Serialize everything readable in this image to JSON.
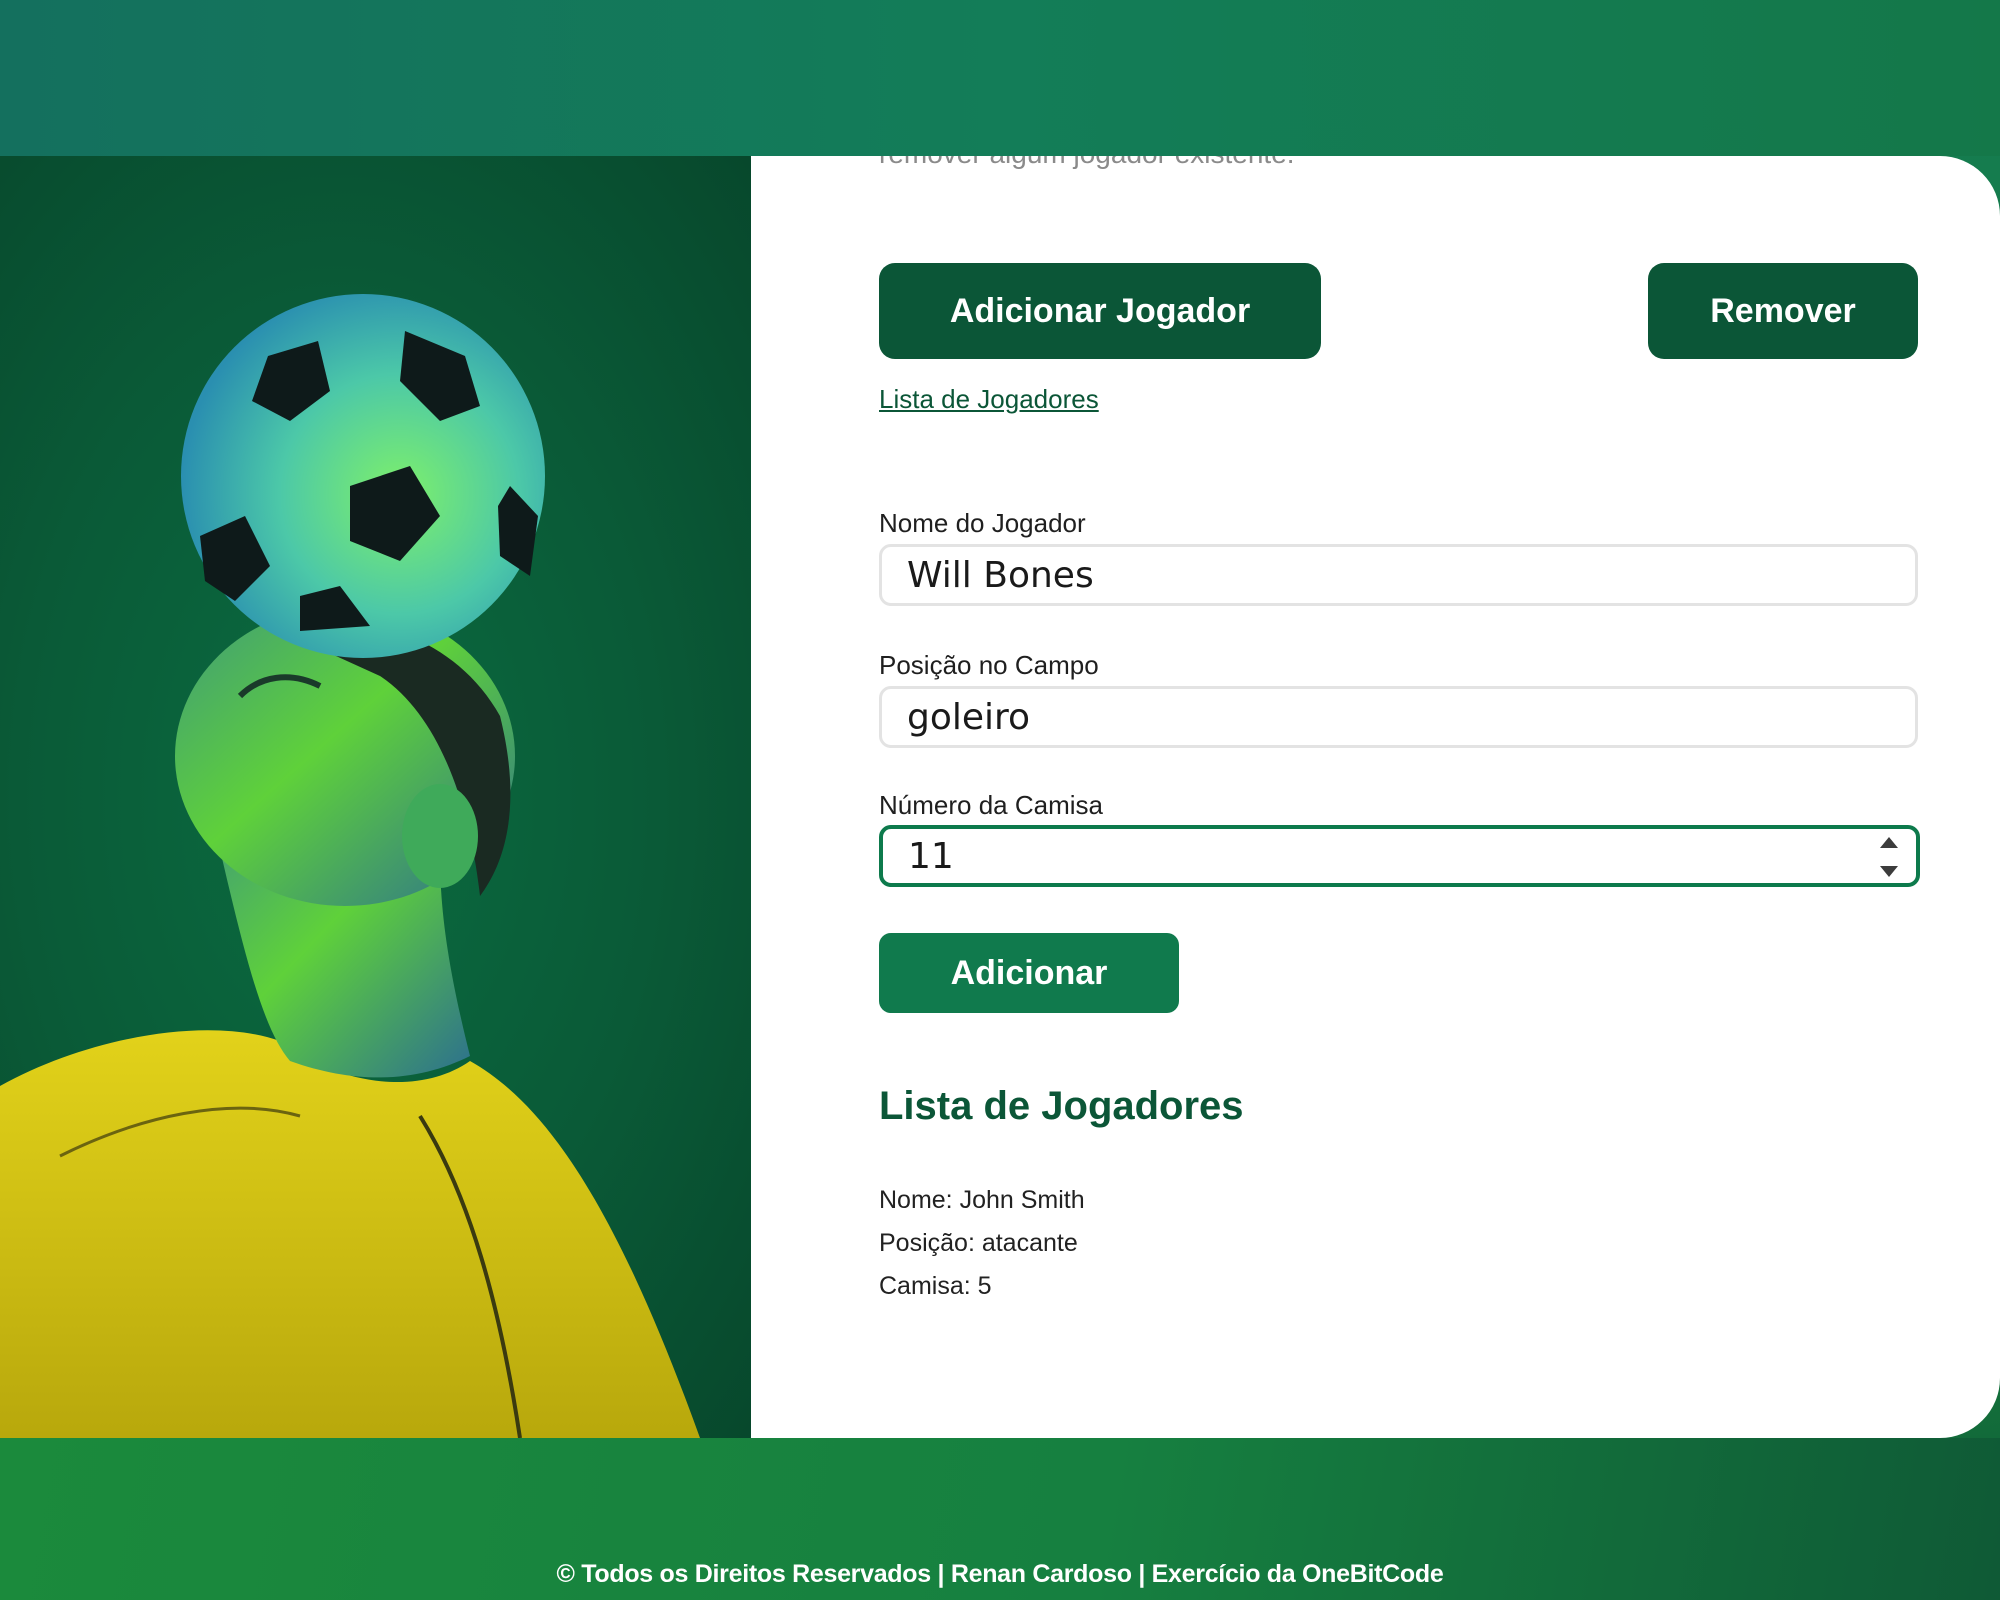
{
  "card": {
    "intro_text_cut": "remover algum jogador existente.",
    "add_player_button": "Adicionar Jogador",
    "remove_button": "Remover",
    "players_link": "Lista de Jogadores"
  },
  "form": {
    "name_label": "Nome do Jogador",
    "name_value": "Will Bones",
    "position_label": "Posição no Campo",
    "position_value": "goleiro",
    "number_label": "Número da Camisa",
    "number_value": "11",
    "submit_button": "Adicionar"
  },
  "player_list": {
    "title": "Lista de Jogadores",
    "players": [
      {
        "name_line": "Nome: John Smith",
        "position_line": "Posição: atacante",
        "shirt_line": "Camisa: 5"
      }
    ]
  },
  "footer": {
    "text": "© Todos os Direitos Reservados | Renan Cardoso | Exercício da OneBitCode"
  },
  "colors": {
    "brand_dark": "#0b5637",
    "brand": "#107a4d",
    "focus_border": "#0d7a4c"
  },
  "icons": {
    "spinner": "up-down-arrows"
  }
}
